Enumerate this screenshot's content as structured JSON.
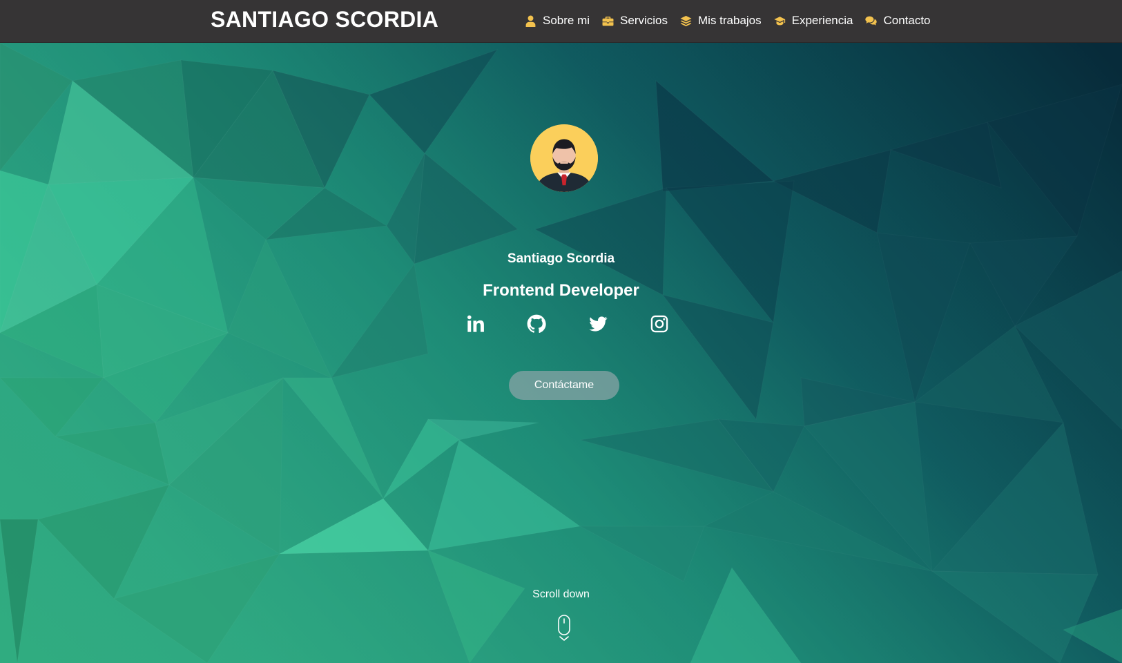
{
  "nav": {
    "brand": "SANTIAGO SCORDIA",
    "items": [
      {
        "label": "Sobre mi",
        "icon": "user-icon"
      },
      {
        "label": "Servicios",
        "icon": "briefcase-icon"
      },
      {
        "label": "Mis trabajos",
        "icon": "layers-icon"
      },
      {
        "label": "Experiencia",
        "icon": "graduation-cap-icon"
      },
      {
        "label": "Contacto",
        "icon": "comments-icon"
      }
    ],
    "icon_color": "#f3c24e",
    "background": "#363435"
  },
  "hero": {
    "name": "Santiago Scordia",
    "role": "Frontend Developer",
    "socials": [
      {
        "icon": "linkedin-icon"
      },
      {
        "icon": "github-icon"
      },
      {
        "icon": "twitter-icon"
      },
      {
        "icon": "instagram-icon"
      }
    ],
    "cta_label": "Contáctame",
    "scroll_label": "Scroll down",
    "scroll_icon": "mouse-icon",
    "avatar_icon": "avatar-icon",
    "colors": {
      "avatar_bg": "#fbcf5b",
      "bg_green": "#3fcf9a",
      "bg_dark": "#072b3a"
    }
  }
}
